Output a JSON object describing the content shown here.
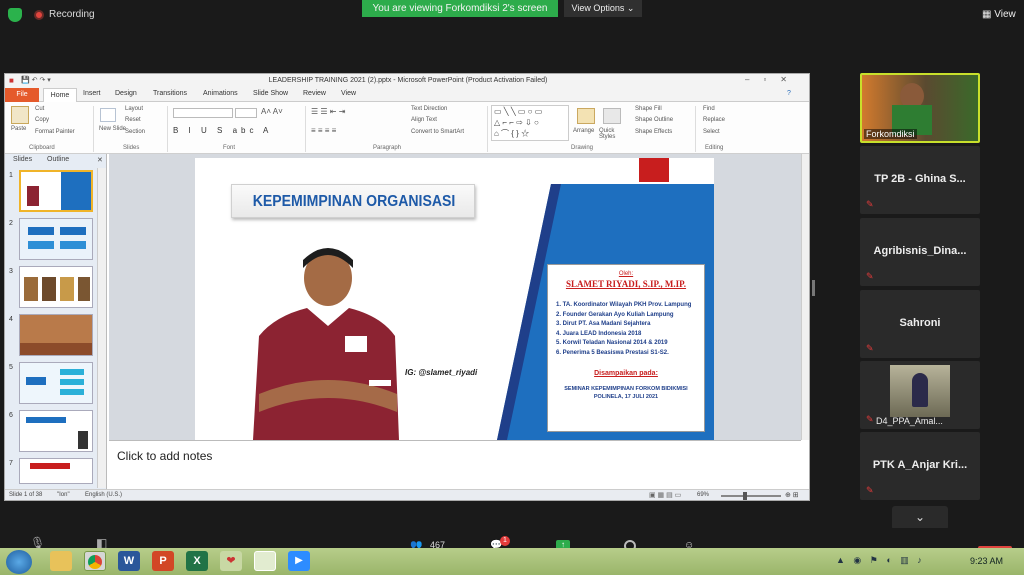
{
  "zoom": {
    "recording_label": "Recording",
    "viewing_banner": "You are viewing Forkomdiksi 2's screen",
    "view_options": "View Options ⌄",
    "view_label": "View",
    "participants_count": "467",
    "chat_badge": "1",
    "colors": {
      "green": "#2dac4b",
      "red": "#e23b3b"
    }
  },
  "ppt": {
    "title": "LEADERSHIP TRAINING 2021 (2).pptx - Microsoft PowerPoint (Product Activation Failed)",
    "tabs": [
      "File",
      "Home",
      "Insert",
      "Design",
      "Transitions",
      "Animations",
      "Slide Show",
      "Review",
      "View"
    ],
    "ribbon": {
      "paste": "Paste",
      "cut": "Cut",
      "copy": "Copy",
      "format_painter": "Format Painter",
      "clipboard": "Clipboard",
      "new_slide": "New Slide",
      "layout": "Layout",
      "reset": "Reset",
      "section": "Section",
      "slides": "Slides",
      "font": "Font",
      "text_direction": "Text Direction",
      "align_text": "Align Text",
      "convert_smartart": "Convert to SmartArt",
      "paragraph": "Paragraph",
      "arrange": "Arrange",
      "quick_styles": "Quick Styles",
      "shape_fill": "Shape Fill",
      "shape_outline": "Shape Outline",
      "shape_effects": "Shape Effects",
      "drawing": "Drawing",
      "find": "Find",
      "replace": "Replace",
      "select": "Select",
      "editing": "Editing"
    },
    "panel_tabs": [
      "Slides",
      "Outline"
    ],
    "slide_numbers": [
      "1",
      "2",
      "3",
      "4",
      "5",
      "6",
      "7"
    ],
    "notes_placeholder": "Click to add notes",
    "status": {
      "slide_of": "Slide 1 of 38",
      "theme": "\"Ion\"",
      "language": "English (U.S.)",
      "zoom": "69%"
    }
  },
  "slide": {
    "title": "KEPEMIMPINAN ORGANISASI",
    "ig": "IG: @slamet_riyadi",
    "oleh": "Oleh:",
    "speaker": "SLAMET RIYADI, S.IP., M.IP.",
    "credentials": [
      "1. TA. Koordinator Wilayah PKH Prov. Lampung",
      "2. Founder Gerakan Ayo Kuliah Lampung",
      "3. Dirut PT. Asa Madani Sejahtera",
      "4. Juara LEAD Indonesia 2018",
      "5. Korwil Teladan Nasional 2014 & 2019",
      "6. Penerima 5 Beasiswa Prestasi S1-S2."
    ],
    "disampaikan": "Disampaikan pada:",
    "event_line1": "SEMINAR KEPEMIMPINAN FORKOM BIDIKMISI",
    "event_line2": "POLINELA, 17 JULI 2021",
    "colors": {
      "blue": "#1e6fbf",
      "red": "#c81e1e",
      "navy": "#1f3f8a"
    }
  },
  "participants": [
    {
      "name": "Forkomdiksi",
      "video": true,
      "active": true
    },
    {
      "name": "TP 2B - Ghina S...",
      "muted": true
    },
    {
      "name": "Agribisnis_Dina...",
      "muted": true
    },
    {
      "name": "Sahroni",
      "muted": true
    },
    {
      "name": "D4_PPA_Amal...",
      "video": true,
      "muted": true
    },
    {
      "name": "PTK A_Anjar Kri...",
      "muted": true
    }
  ],
  "taskbar": {
    "time": "9:23 AM",
    "apps": [
      "start-orb",
      "explorer",
      "chrome",
      "word",
      "powerpoint",
      "excel",
      "app-red",
      "app-generic",
      "zoom"
    ]
  }
}
